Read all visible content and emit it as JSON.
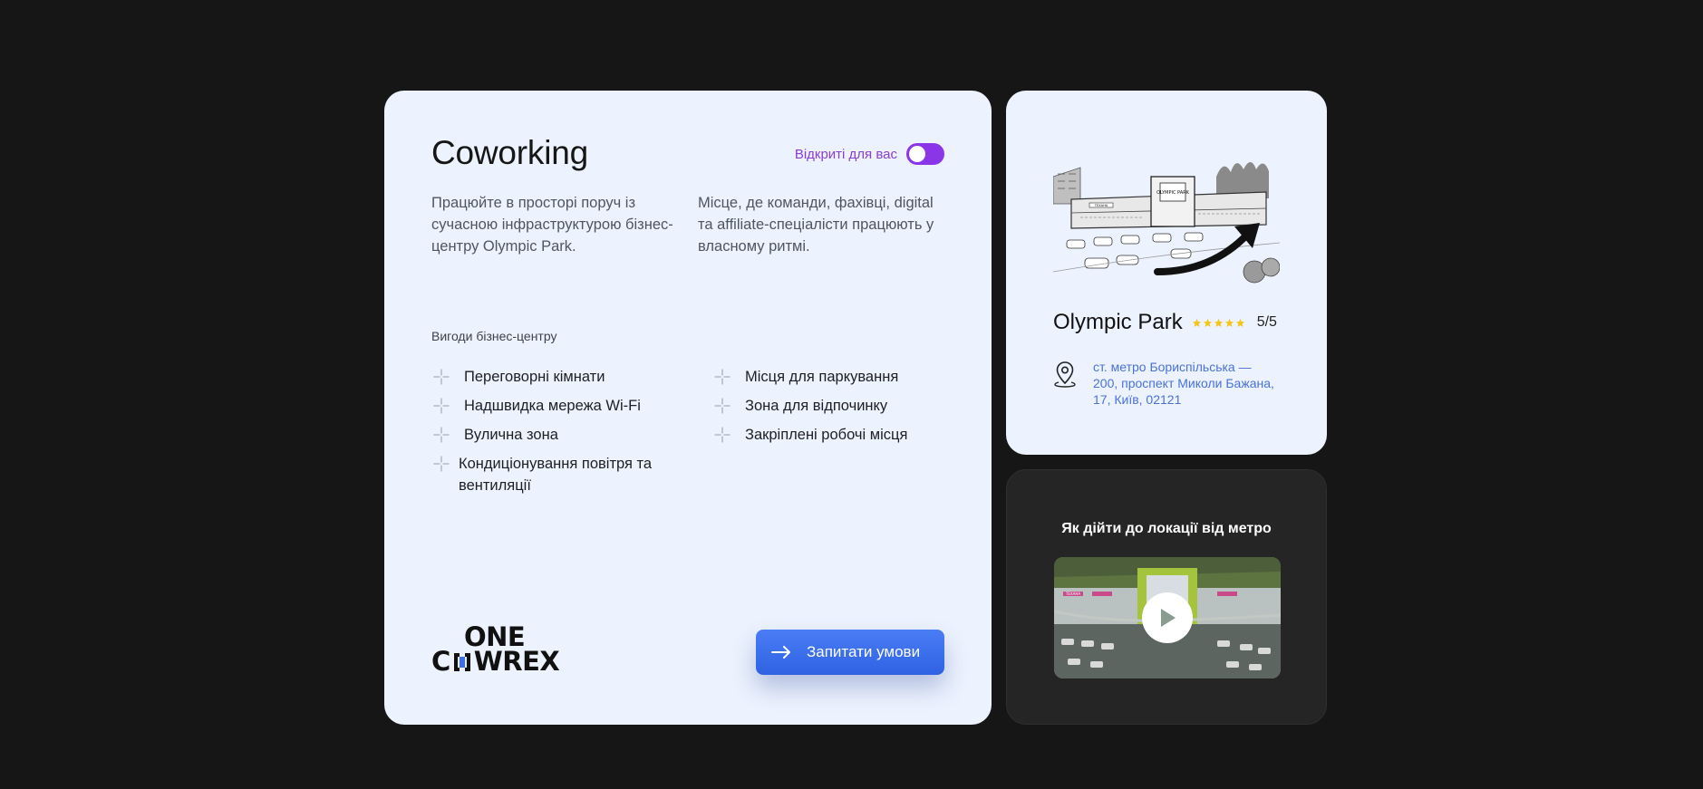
{
  "coworking": {
    "title": "Coworking",
    "toggle_label": "Відкриті для вас",
    "toggle_on": true,
    "desc_left": "Працюйте в просторі поруч із сучасною інфраструктурою бізнес-центру Olympic Park.",
    "desc_right": "Місце, де команди, фахівці, digital та affiliate-спеціалісти працюють у власному ритмі.",
    "benefits_heading": "Вигоди бізнес-центру",
    "benefits_left": [
      "Переговорні кімнати",
      "Надшвидка мережа Wi-Fi",
      "Вулична зона",
      "Кондиціонування повітря та вентиляції"
    ],
    "benefits_right": [
      "Місця для паркування",
      "Зона для відпочинку",
      "Закріплені робочі місця"
    ],
    "logo_line1": "ONE",
    "logo_line2_a": "C",
    "logo_line2_b": "WREX",
    "cta_label": "Запитати умови"
  },
  "location": {
    "name": "Olympic Park",
    "stars": 5,
    "rating": "5/5",
    "address": "ст. метро Бориспільська — 200, проспект Миколи Бажана, 17, Київ, 02121",
    "image_sign": "OLYMPIC PARK",
    "image_banner": "TEXAHA"
  },
  "video": {
    "title": "Як дійти до локації від метро",
    "thumb_banner": "TEXAHA"
  },
  "colors": {
    "accent_purple": "#8b35e8",
    "cta_blue": "#3a6ff0",
    "card_bg": "#ecf2fe",
    "page_bg": "#161616",
    "star": "#f5c518"
  }
}
